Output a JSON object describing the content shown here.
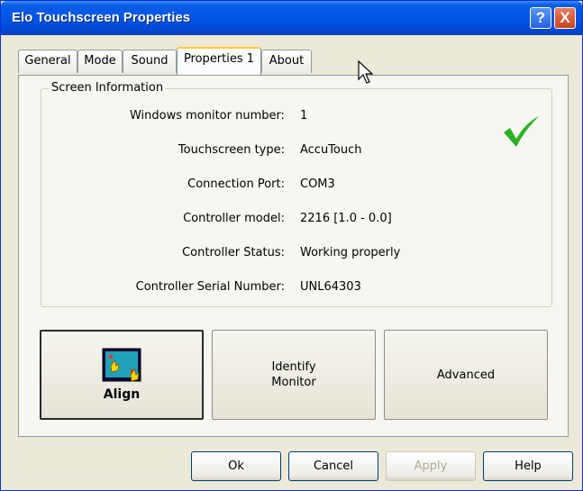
{
  "window": {
    "title": "Elo Touchscreen Properties"
  },
  "titlebar_buttons": {
    "help": "?",
    "close": "X"
  },
  "tabs": [
    {
      "label": "General"
    },
    {
      "label": "Mode"
    },
    {
      "label": "Sound"
    },
    {
      "label": "Properties 1",
      "active": true
    },
    {
      "label": "About"
    }
  ],
  "screen_info": {
    "legend": "Screen Information",
    "rows": [
      {
        "label": "Windows monitor number:",
        "value": "1"
      },
      {
        "label": "Touchscreen type:",
        "value": "AccuTouch"
      },
      {
        "label": "Connection Port:",
        "value": "COM3"
      },
      {
        "label": "Controller model:",
        "value": "2216 [1.0 - 0.0]"
      },
      {
        "label": "Controller Status:",
        "value": "Working properly"
      },
      {
        "label": "Controller Serial Number:",
        "value": "UNL64303"
      }
    ],
    "status_icon": "checkmark-icon",
    "status_color": "#2bb024"
  },
  "actions": {
    "align": "Align",
    "identify_line1": "Identify",
    "identify_line2": "Monitor",
    "advanced": "Advanced"
  },
  "dialog_buttons": {
    "ok": "Ok",
    "cancel": "Cancel",
    "apply": "Apply",
    "help": "Help"
  },
  "colors": {
    "titlebar": "#0055e5",
    "window_bg": "#ece9d8",
    "active_tab_accent": "#ffc83c"
  }
}
